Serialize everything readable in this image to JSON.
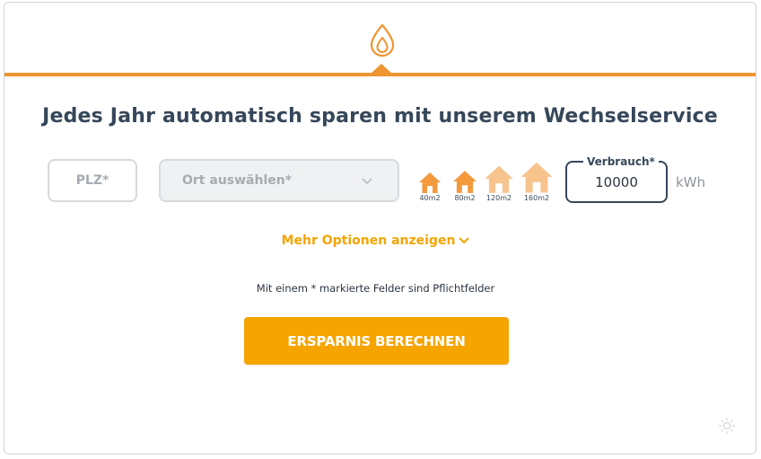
{
  "header": {
    "icon": "flame-icon",
    "accent_color": "#ee9430"
  },
  "headline": "Jedes Jahr automatisch sparen mit unserem Wechselservice",
  "form": {
    "plz_placeholder": "PLZ*",
    "ort_placeholder": "Ort auswählen*",
    "houses": [
      {
        "label": "40m2",
        "selected": true
      },
      {
        "label": "80m2",
        "selected": true
      },
      {
        "label": "120m2",
        "selected": false
      },
      {
        "label": "160m2",
        "selected": false
      }
    ],
    "verbrauch_label": "Verbrauch*",
    "verbrauch_value": "10000",
    "unit": "kWh"
  },
  "more_options": "Mehr Optionen anzeigen",
  "required_hint": "Mit einem * markierte Felder sind Pflichtfelder",
  "submit_label": "ERSPARNIS BERECHNEN",
  "colors": {
    "primary": "#f5a400",
    "house_active": "#f29a3c",
    "house_inactive": "#f8c48e",
    "text": "#36475a"
  },
  "footer": {
    "icon": "sun-icon"
  }
}
